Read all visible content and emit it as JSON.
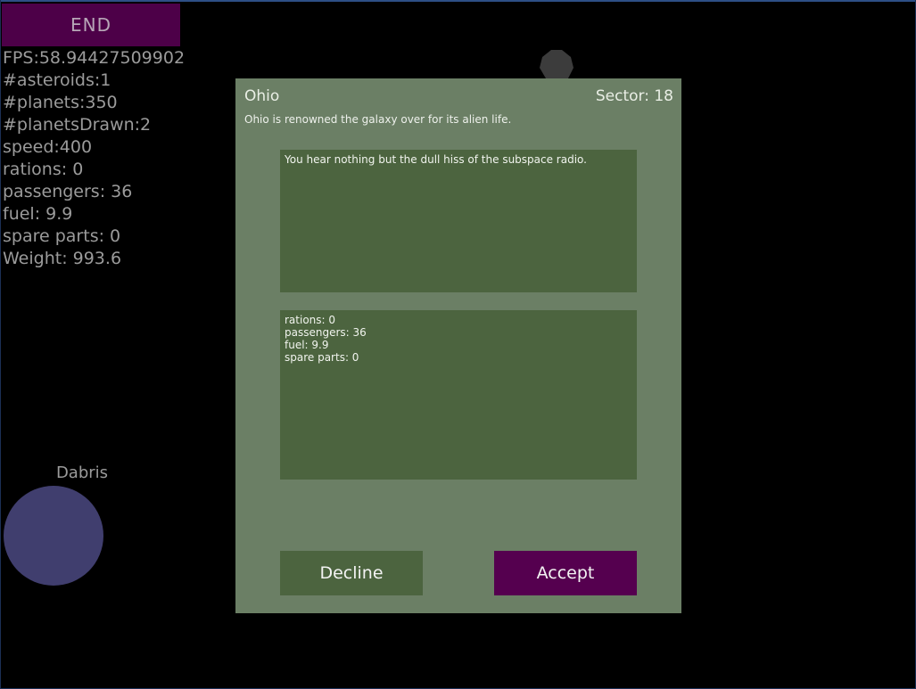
{
  "hud": {
    "end_label": "END",
    "stats": [
      "FPS:58.94427509902",
      "#asteroids:1",
      "#planets:350",
      "#planetsDrawn:2",
      "speed:400",
      "rations: 0",
      "passengers: 36",
      "fuel: 9.9",
      "spare parts: 0",
      "Weight: 993.6"
    ]
  },
  "world": {
    "planet_name": "Dabris",
    "planet_color": "#403e6e",
    "asteroid_color": "#3c3c3c"
  },
  "dialog": {
    "title": "Ohio",
    "sector": "Sector: 18",
    "description": "Ohio is renowned the galaxy over for its alien life.",
    "message": "You hear nothing but the dull hiss of the subspace radio.",
    "inventory": [
      "rations: 0",
      "passengers: 36",
      "fuel: 9.9",
      "spare parts: 0"
    ],
    "decline_label": "Decline",
    "accept_label": "Accept"
  },
  "colors": {
    "background": "#000000",
    "dialog_bg": "#6b7f65",
    "panel_bg": "#4c643f",
    "accent": "#55004f"
  }
}
